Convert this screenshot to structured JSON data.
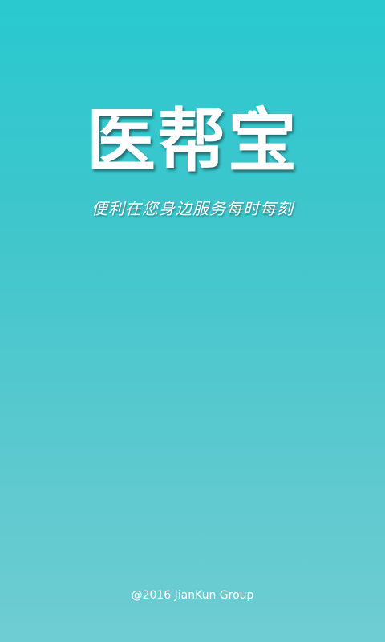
{
  "brand": {
    "title": "医帮宝",
    "slogan": "便利在您身边服务每时每刻"
  },
  "footer": {
    "copyright": "@2016 JianKun Group"
  },
  "colors": {
    "background_top": "#29c9d0",
    "background_bottom": "#6ecdd2",
    "text": "#ffffff"
  },
  "icons": {
    "logo_accent": "heart-icon"
  }
}
